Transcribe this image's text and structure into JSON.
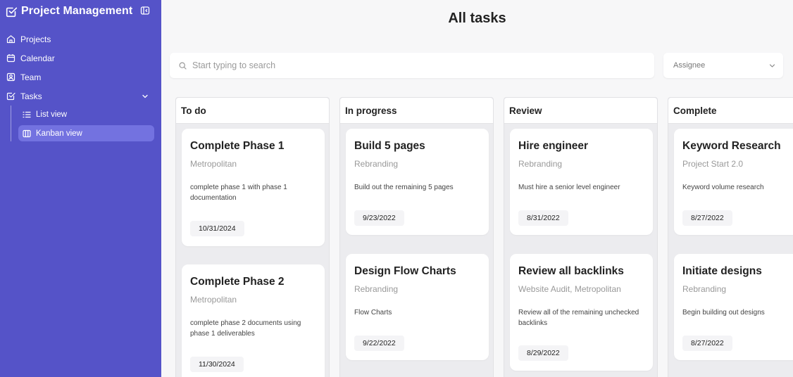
{
  "app": {
    "title": "Project Management"
  },
  "sidebar": {
    "items": [
      {
        "label": "Projects",
        "icon": "home-icon"
      },
      {
        "label": "Calendar",
        "icon": "calendar-icon"
      },
      {
        "label": "Team",
        "icon": "team-icon"
      },
      {
        "label": "Tasks",
        "icon": "tasks-icon"
      }
    ],
    "subitems": [
      {
        "label": "List view",
        "icon": "list-icon"
      },
      {
        "label": "Kanban view",
        "icon": "kanban-icon",
        "active": true
      }
    ]
  },
  "main": {
    "title": "All tasks",
    "search": {
      "placeholder": "Start typing to search",
      "value": ""
    },
    "assignee": {
      "label": "Assignee"
    }
  },
  "board": {
    "columns": [
      {
        "title": "To do",
        "cards": [
          {
            "title": "Complete Phase 1",
            "project": "Metropolitan",
            "desc": "complete phase 1 with phase 1 documentation",
            "date": "10/31/2024"
          },
          {
            "title": "Complete Phase 2",
            "project": "Metropolitan",
            "desc": "complete phase 2 documents using phase 1 deliverables",
            "date": "11/30/2024"
          }
        ]
      },
      {
        "title": "In progress",
        "cards": [
          {
            "title": "Build 5 pages",
            "project": "Rebranding",
            "desc": "Build out the remaining 5 pages",
            "date": "9/23/2022"
          },
          {
            "title": "Design Flow Charts",
            "project": "Rebranding",
            "desc": "Flow Charts",
            "date": "9/22/2022"
          }
        ]
      },
      {
        "title": "Review",
        "cards": [
          {
            "title": "Hire engineer",
            "project": "Rebranding",
            "desc": "Must hire a senior level engineer",
            "date": "8/31/2022"
          },
          {
            "title": "Review all backlinks",
            "project": "Website Audit, Metropolitan",
            "desc": "Review all of the remaining unchecked backlinks",
            "date": "8/29/2022"
          }
        ]
      },
      {
        "title": "Complete",
        "cards": [
          {
            "title": "Keyword Research",
            "project": "Project Start 2.0",
            "desc": "Keyword volume research",
            "date": "8/27/2022"
          },
          {
            "title": "Initiate designs",
            "project": "Rebranding",
            "desc": "Begin building out designs",
            "date": "8/27/2022"
          }
        ]
      }
    ]
  },
  "colors": {
    "sidebar": "#5553c8",
    "active_item": "#7372e0",
    "background": "#f7f7f8"
  }
}
